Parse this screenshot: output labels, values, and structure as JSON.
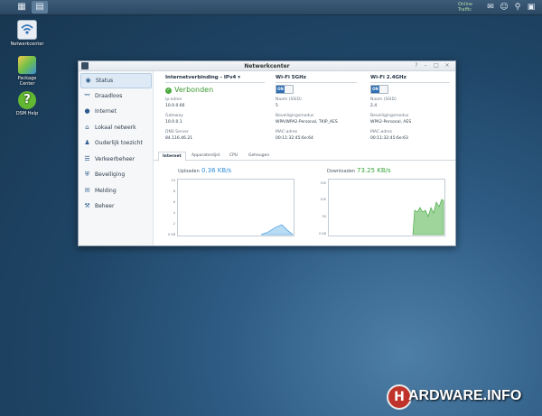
{
  "taskbar": {
    "status_line1": "Online",
    "status_line2": "Traffic"
  },
  "desktop": {
    "icons": [
      {
        "label": "Netwerkcenter"
      },
      {
        "label": "Package Center"
      },
      {
        "label": "DSM Help"
      }
    ]
  },
  "window": {
    "title": "Netwerkcenter",
    "sidebar": [
      {
        "label": "Status",
        "icon": "status-icon"
      },
      {
        "label": "Draadloos",
        "icon": "wifi-icon"
      },
      {
        "label": "Internet",
        "icon": "globe-icon"
      },
      {
        "label": "Lokaal netwerk",
        "icon": "house-icon"
      },
      {
        "label": "Ouderlijk toezicht",
        "icon": "family-icon"
      },
      {
        "label": "Verkeerbeheer",
        "icon": "sliders-icon"
      },
      {
        "label": "Beveiliging",
        "icon": "shield-icon"
      },
      {
        "label": "Melding",
        "icon": "bell-icon"
      },
      {
        "label": "Beheer",
        "icon": "tools-icon"
      }
    ],
    "internet": {
      "title": "Internetverbinding - IPv4 ▾",
      "status": "Verbonden",
      "ip_label": "Ip-adres",
      "ip_value": "10.0.0.66",
      "gateway_label": "Gateway",
      "gateway_value": "10.0.0.1",
      "dns_label": "DNS Server",
      "dns_value": "84.116.46.21"
    },
    "wifi5": {
      "title": "Wi-Fi 5GHz",
      "toggle": "ON",
      "ssid_label": "Naam (SSID)",
      "ssid_value": "5",
      "sec_label": "Beveiligingsmodus",
      "sec_value": "WPA/WPA2-Personal, TKIP_AES",
      "mac_label": "MAC-adres",
      "mac_value": "00:11:32:45:6e:64"
    },
    "wifi24": {
      "title": "Wi-Fi 2.4GHz",
      "toggle": "ON",
      "ssid_label": "Naam (SSID)",
      "ssid_value": "2.4",
      "sec_label": "Beveiligingsmodus",
      "sec_value": "WPA2-Personal, AES",
      "mac_label": "MAC-adres",
      "mac_value": "00:11:32:45:6e:63"
    },
    "tabs": [
      "Internet",
      "Apparatenlijst",
      "CPU",
      "Geheugen"
    ],
    "upload": {
      "label": "Uploaden",
      "value": "0.36 KB/s",
      "ticks": [
        "10",
        "8",
        "6",
        "4",
        "2",
        "0 KB"
      ]
    },
    "download": {
      "label": "Downloaden",
      "value": "73.25 KB/s",
      "ticks": [
        "150",
        "100",
        "50",
        "0 KB"
      ]
    }
  },
  "colors": {
    "upload": "#2f8fd6",
    "download": "#3aa43a",
    "upload_fill": "#b9dcf5",
    "download_fill": "#9fd49a"
  }
}
